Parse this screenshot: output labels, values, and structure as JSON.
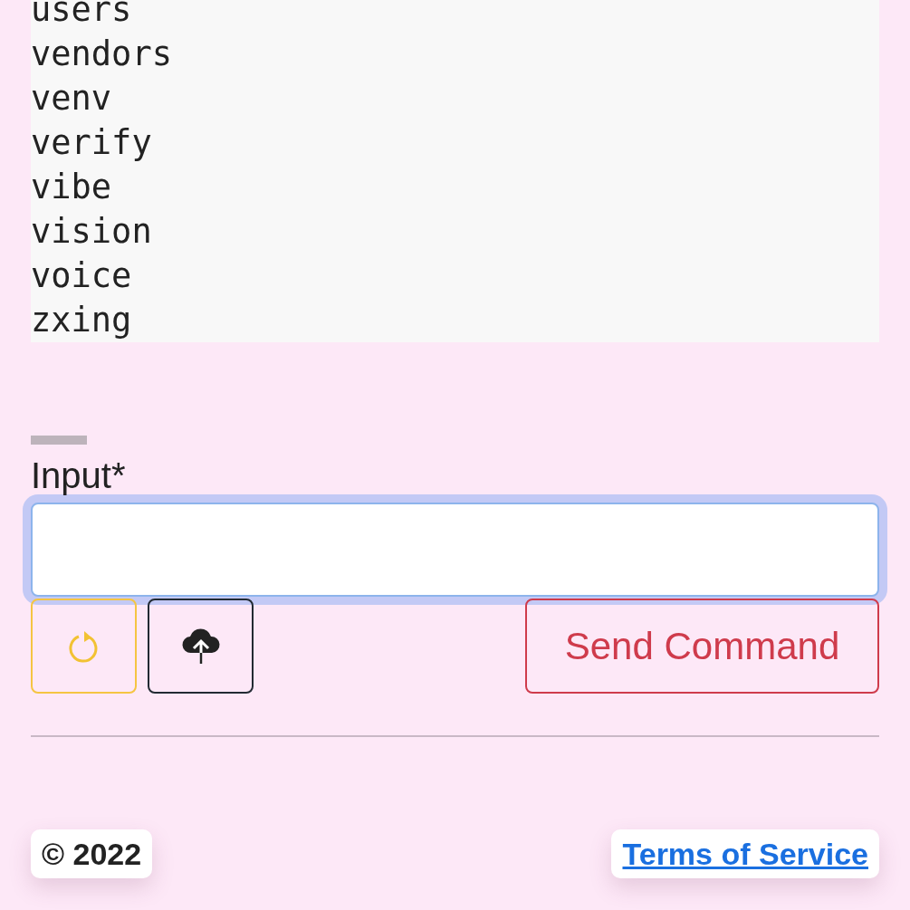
{
  "output_lines": [
    "users",
    "vendors",
    "venv",
    "verify",
    "vibe",
    "vision",
    "voice",
    "zxing"
  ],
  "input": {
    "label": "Input*",
    "focused": true
  },
  "actions": [
    {
      "kind": "refresh"
    },
    {
      "kind": "upload"
    },
    {
      "kind": "send",
      "label": "Send Command"
    }
  ],
  "footer": {
    "copyright": "© 2022",
    "link": "Terms of Service"
  }
}
